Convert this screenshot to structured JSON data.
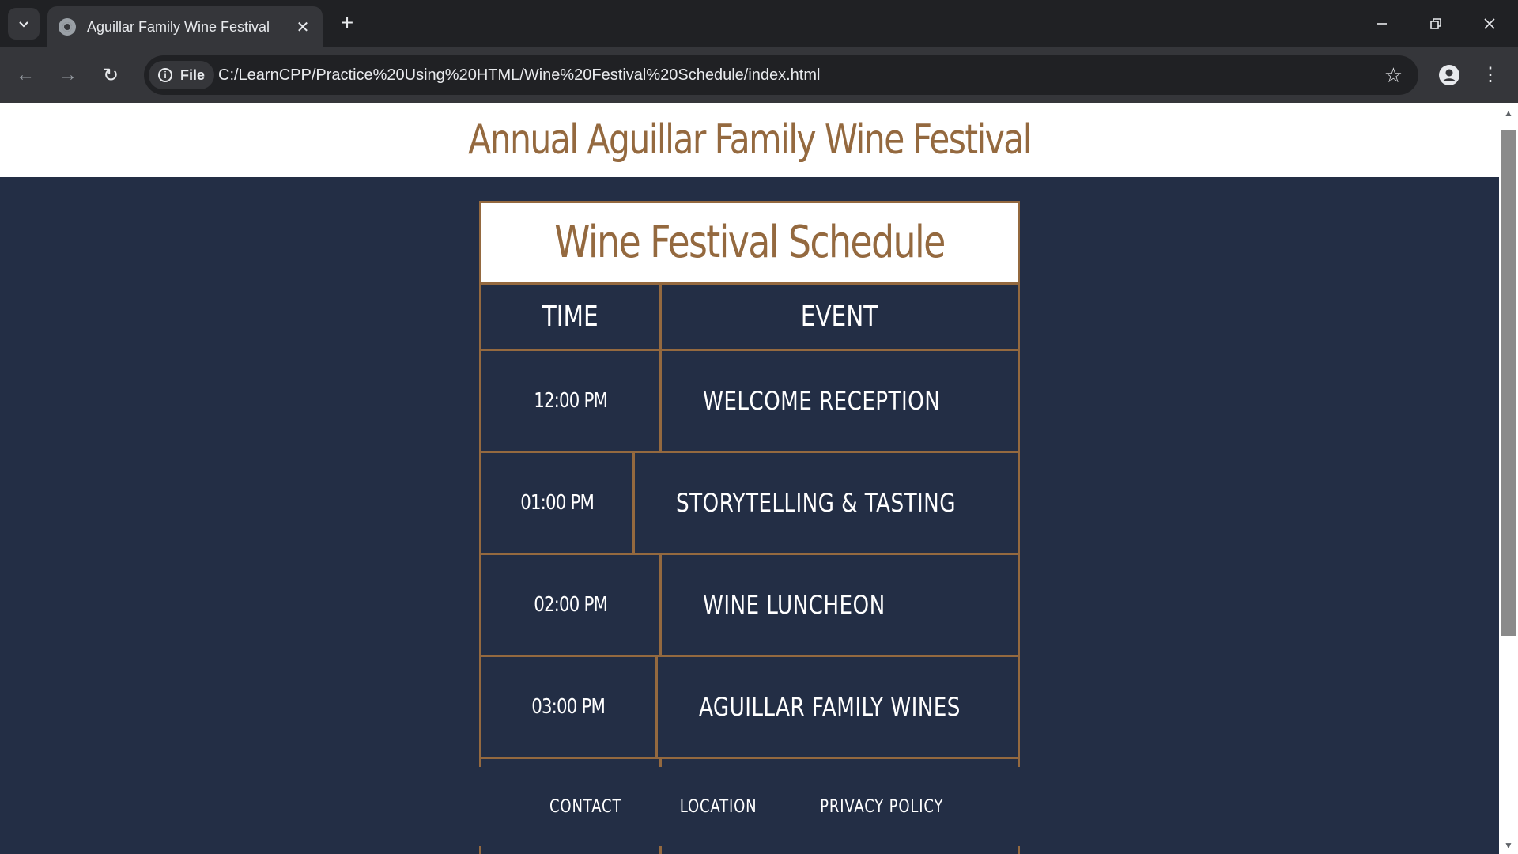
{
  "browser": {
    "tab_title": "Aguillar Family Wine Festival",
    "tab_close": "✕",
    "new_tab": "+",
    "site_chip": "File",
    "url": "C:/LearnCPP/Practice%20Using%20HTML/Wine%20Festival%20Schedule/index.html",
    "window_controls": {
      "minimize": "–",
      "restore": "❐",
      "close": "✕"
    },
    "nav": {
      "back": "←",
      "forward": "→",
      "reload": "↻"
    },
    "bookmark": "☆",
    "menu": "⋮"
  },
  "page": {
    "heading": "Annual Aguillar Family Wine Festival",
    "schedule": {
      "caption": "Wine Festival Schedule",
      "columns": [
        "TIME",
        "EVENT"
      ],
      "rows": [
        {
          "time": "12:00 PM",
          "event": "WELCOME RECEPTION"
        },
        {
          "time": "01:00 PM",
          "event": "STORYTELLING & TASTING"
        },
        {
          "time": "02:00 PM",
          "event": "WINE LUNCHEON"
        },
        {
          "time": "03:00 PM",
          "event": "AGUILLAR FAMILY WINES"
        }
      ]
    },
    "footer_links": [
      "CONTACT",
      "LOCATION",
      "PRIVACY POLICY"
    ]
  },
  "colors": {
    "accent": "#94693f",
    "page_bg": "#232e45",
    "header_bg": "#ffffff"
  }
}
